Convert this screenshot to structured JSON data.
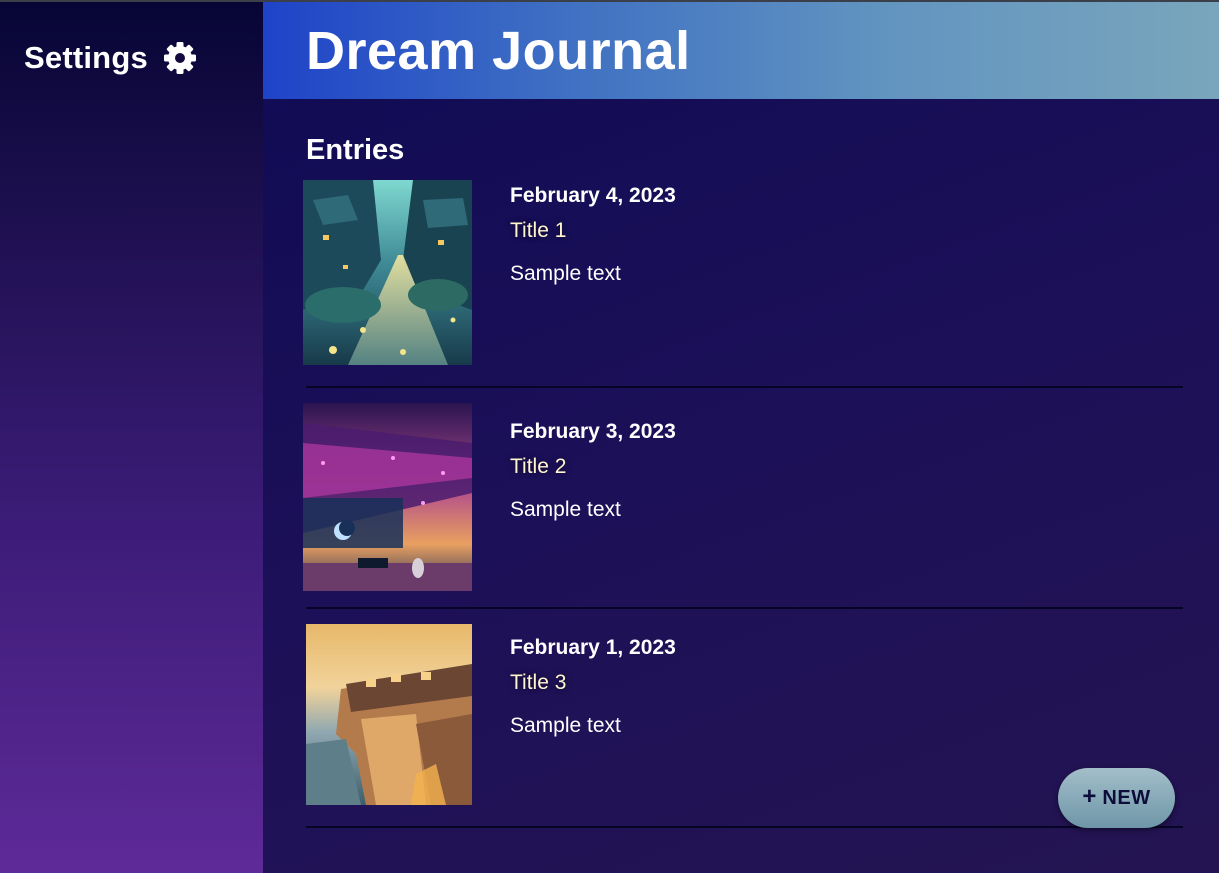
{
  "sidebar": {
    "settings_label": "Settings",
    "settings_icon": "gear-icon"
  },
  "header": {
    "title": "Dream Journal"
  },
  "main": {
    "heading": "Entries",
    "entries": [
      {
        "date": "February 4, 2023",
        "title": "Title 1",
        "text": "Sample text"
      },
      {
        "date": "February 3, 2023",
        "title": "Title 2",
        "text": "Sample text"
      },
      {
        "date": "February 1, 2023",
        "title": "Title 3",
        "text": "Sample text"
      }
    ]
  },
  "fab": {
    "icon": "plus-icon",
    "label": "NEW"
  },
  "colors": {
    "header_gradient_start": "#1f43c8",
    "header_gradient_end": "#79a6bc",
    "main_background": "#17104f",
    "sidebar_gradient_end": "#5e2a98",
    "fab_background": "#8fb0bf"
  }
}
